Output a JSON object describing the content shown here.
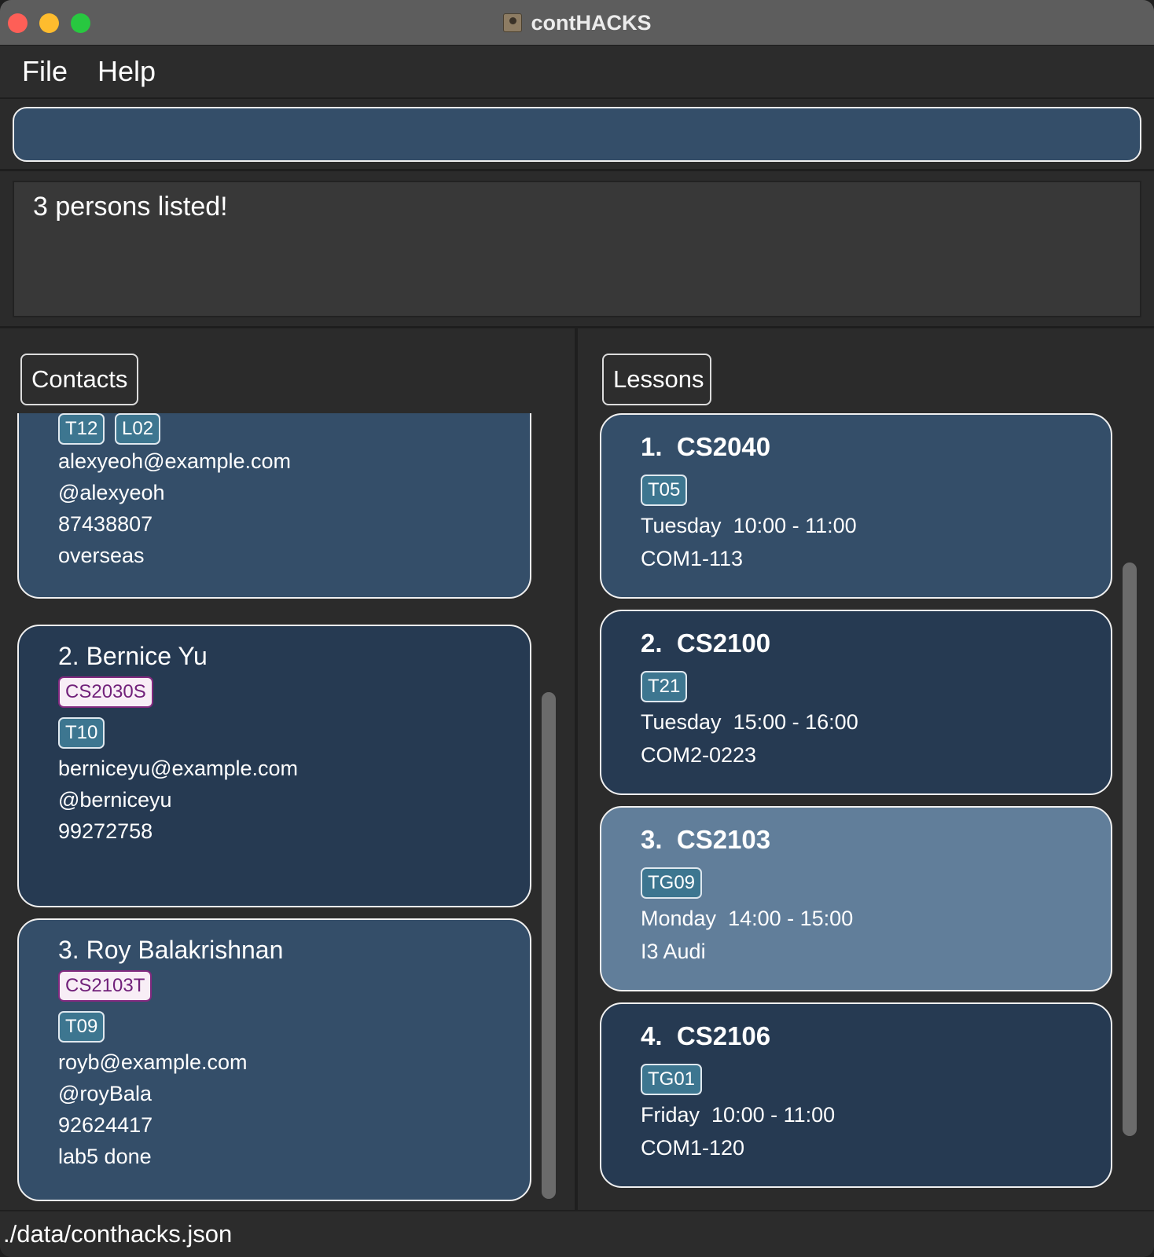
{
  "window": {
    "title": "contHACKS",
    "app_icon": "contacts-book-icon"
  },
  "menu": {
    "items": [
      "File",
      "Help"
    ]
  },
  "command": {
    "value": "",
    "placeholder": ""
  },
  "result": {
    "message": "3 persons listed!"
  },
  "contacts": {
    "tab_label": "Contacts",
    "cards": [
      {
        "title": "",
        "module_tag": "",
        "group_tags": [
          "T12",
          "L02"
        ],
        "email": "alexyeoh@example.com",
        "telegram": "@alexyeoh",
        "phone": "87438807",
        "remark": "overseas"
      },
      {
        "title": "2. Bernice Yu",
        "module_tag": "CS2030S",
        "group_tags": [
          "T10"
        ],
        "email": "berniceyu@example.com",
        "telegram": "@berniceyu",
        "phone": "99272758",
        "remark": ""
      },
      {
        "title": "3. Roy Balakrishnan",
        "module_tag": "CS2103T",
        "group_tags": [
          "T09"
        ],
        "email": "royb@example.com",
        "telegram": "@royBala",
        "phone": "92624417",
        "remark": "lab5 done"
      }
    ]
  },
  "lessons": {
    "tab_label": "Lessons",
    "cards": [
      {
        "index": "1.",
        "module": "CS2040",
        "group": "T05",
        "day": "Tuesday",
        "time": "10:00 - 11:00",
        "venue": "COM1-113"
      },
      {
        "index": "2.",
        "module": "CS2100",
        "group": "T21",
        "day": "Tuesday",
        "time": "15:00 - 16:00",
        "venue": "COM2-0223"
      },
      {
        "index": "3.",
        "module": "CS2103",
        "group": "TG09",
        "day": "Monday",
        "time": "14:00 - 15:00",
        "venue": "I3 Audi",
        "selected": true
      },
      {
        "index": "4.",
        "module": "CS2106",
        "group": "TG01",
        "day": "Friday",
        "time": "10:00 - 11:00",
        "venue": "COM1-120"
      }
    ]
  },
  "status": {
    "file_path": "./data/conthacks.json"
  },
  "colors": {
    "card": "#344e69",
    "card_dark": "#263a52",
    "card_selected": "#617e9a",
    "tag_teal": "#3d7690",
    "tag_plum_text": "#71217a"
  }
}
